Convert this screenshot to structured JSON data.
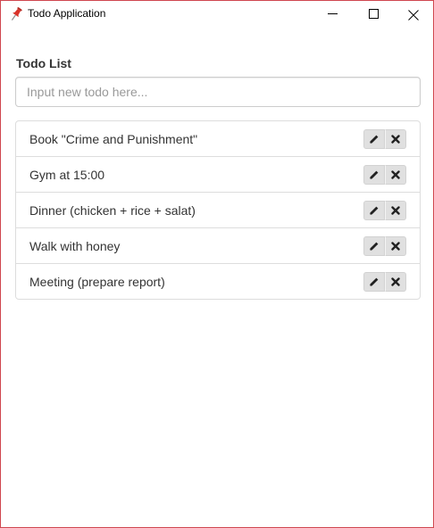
{
  "window": {
    "title": "Todo Application",
    "app_icon": "pushpin-icon",
    "controls": [
      "minimize-icon",
      "maximize-icon",
      "close-icon"
    ]
  },
  "main": {
    "heading": "Todo List",
    "input": {
      "value": "",
      "placeholder": "Input new todo here..."
    },
    "todos": [
      {
        "text": "Book \"Crime and Punishment\""
      },
      {
        "text": "Gym at 15:00"
      },
      {
        "text": "Dinner (chicken + rice + salat)"
      },
      {
        "text": "Walk with honey"
      },
      {
        "text": "Meeting (prepare report)"
      }
    ],
    "item_actions": [
      "pencil-icon",
      "x-icon"
    ]
  },
  "colors": {
    "window_border": "#d0474f",
    "pin_red": "#d9342b",
    "button_bg": "#e0e0e0",
    "text": "#333333",
    "placeholder": "#999999"
  }
}
